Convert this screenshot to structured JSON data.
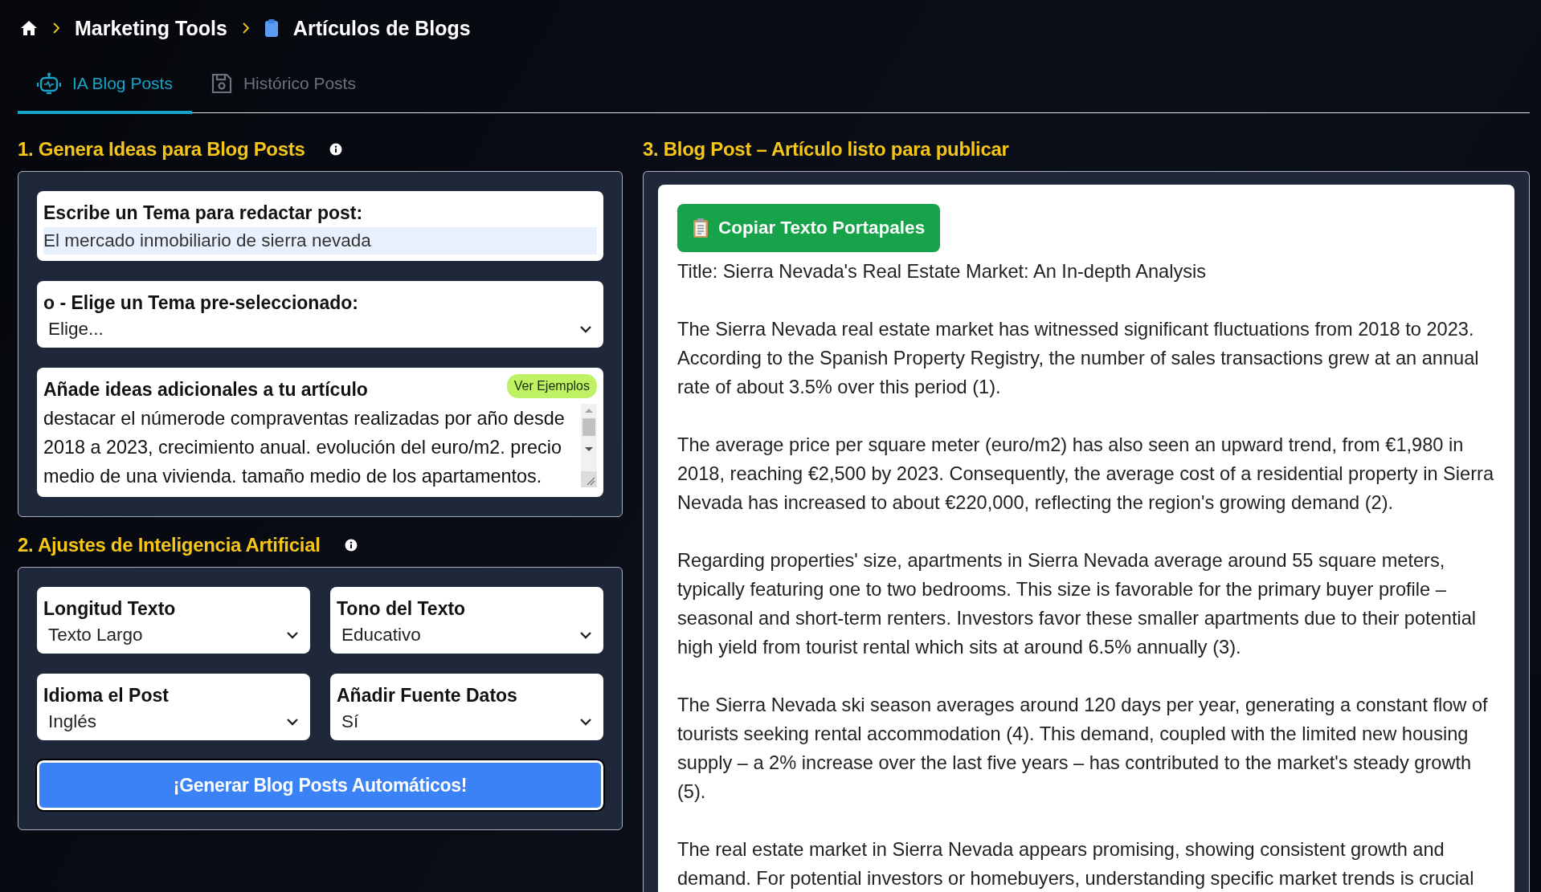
{
  "breadcrumb": [
    {
      "kind": "home"
    },
    {
      "kind": "link",
      "label": "Marketing Tools"
    },
    {
      "kind": "page",
      "label": "Artículos de Blogs"
    }
  ],
  "tabs": [
    {
      "label": "IA Blog Posts",
      "selected": true
    },
    {
      "label": "Histórico Posts",
      "selected": false
    }
  ],
  "ideas": {
    "title": "1. Genera Ideas para Blog Posts",
    "topic": {
      "label": "Escribe un Tema para redactar post:",
      "value": "El mercado inmobiliario de sierra nevada"
    },
    "preset": {
      "label": "o - Elige un Tema pre-seleccionado:",
      "value": "Elige..."
    },
    "extra": {
      "label": "Añade ideas adicionales a tu artículo",
      "badge": "Ver Ejemplos",
      "value": "destacar el númerode compraventas realizadas por año desde 2018 a 2023, crecimiento anual. evolución del euro/m2. precio medio de una vivienda. tamaño medio de los apartamentos."
    }
  },
  "settings": {
    "title": "2. Ajustes de Inteligencia Artificial",
    "selects": [
      {
        "label": "Longitud Texto",
        "value": "Texto Largo"
      },
      {
        "label": "Tono del Texto",
        "value": "Educativo"
      },
      {
        "label": "Idioma el Post",
        "value": "Inglés"
      },
      {
        "label": "Añadir Fuente Datos",
        "value": "Sí"
      }
    ],
    "button": "¡Generar Blog Posts Automáticos!"
  },
  "article": {
    "title": "3. Blog Post – Artículo listo para publicar",
    "copy_button": "Copiar Texto Portapales",
    "heading": "Title: Sierra Nevada's Real Estate Market: An In-depth Analysis",
    "paragraphs": [
      "The Sierra Nevada real estate market has witnessed significant fluctuations from 2018 to 2023. According to the Spanish Property Registry, the number of sales transactions grew at an annual rate of about 3.5% over this period (1).",
      "The average price per square meter (euro/m2) has also seen an upward trend, from €1,980 in 2018, reaching €2,500 by 2023. Consequently, the average cost of a residential property in Sierra Nevada has increased to about €220,000, reflecting the region's growing demand (2).",
      "Regarding properties' size, apartments in Sierra Nevada average around 55 square meters, typically featuring one to two bedrooms. This size is favorable for the primary buyer profile – seasonal and short-term renters. Investors favor these smaller apartments due to their potential high yield from tourist rental which sits at around 6.5% annually (3).",
      "The Sierra Nevada ski season averages around 120 days per year, generating a constant flow of tourists seeking rental accommodation (4). This demand, coupled with the limited new housing supply – a 2% increase over the last five years – has contributed to the market's steady growth (5).",
      "The real estate market in Sierra Nevada appears promising, showing consistent growth and demand. For potential investors or homebuyers, understanding specific market trends is crucial"
    ]
  }
}
